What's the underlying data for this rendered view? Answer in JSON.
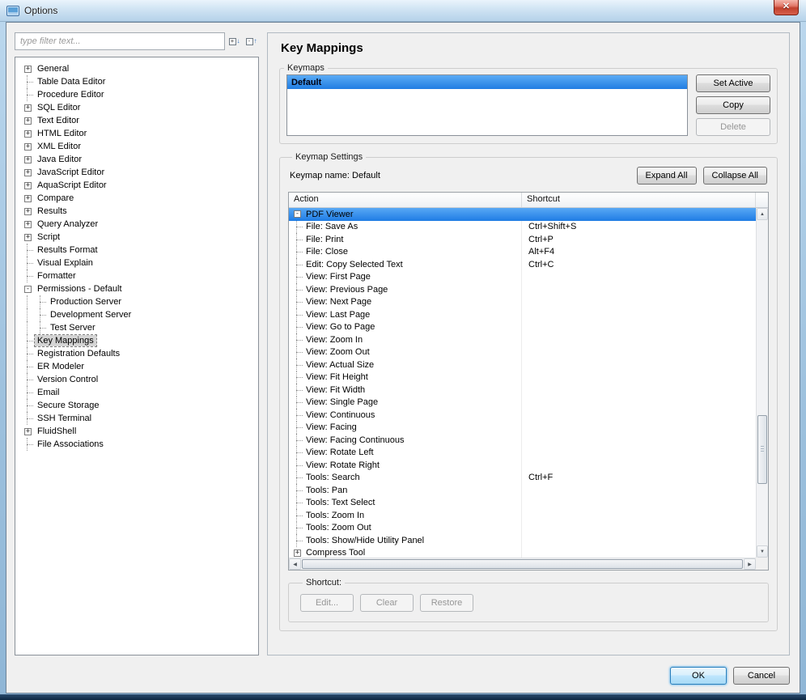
{
  "titlebar": {
    "title": "Options",
    "close_glyph": "✕"
  },
  "filter": {
    "placeholder": "type filter text..."
  },
  "tree": {
    "items": [
      {
        "label": "General",
        "box": "plus",
        "level": 0
      },
      {
        "label": "Table Data Editor",
        "box": null,
        "level": 0
      },
      {
        "label": "Procedure Editor",
        "box": null,
        "level": 0
      },
      {
        "label": "SQL Editor",
        "box": "plus",
        "level": 0
      },
      {
        "label": "Text Editor",
        "box": "plus",
        "level": 0
      },
      {
        "label": "HTML Editor",
        "box": "plus",
        "level": 0
      },
      {
        "label": "XML Editor",
        "box": "plus",
        "level": 0
      },
      {
        "label": "Java Editor",
        "box": "plus",
        "level": 0
      },
      {
        "label": "JavaScript Editor",
        "box": "plus",
        "level": 0
      },
      {
        "label": "AquaScript Editor",
        "box": "plus",
        "level": 0
      },
      {
        "label": "Compare",
        "box": "plus",
        "level": 0
      },
      {
        "label": "Results",
        "box": "plus",
        "level": 0
      },
      {
        "label": "Query Analyzer",
        "box": "plus",
        "level": 0
      },
      {
        "label": "Script",
        "box": "plus",
        "level": 0
      },
      {
        "label": "Results Format",
        "box": null,
        "level": 0
      },
      {
        "label": "Visual Explain",
        "box": null,
        "level": 0
      },
      {
        "label": "Formatter",
        "box": null,
        "level": 0
      },
      {
        "label": "Permissions - Default",
        "box": "minus",
        "level": 0
      },
      {
        "label": "Production Server",
        "box": null,
        "level": 1
      },
      {
        "label": "Development Server",
        "box": null,
        "level": 1
      },
      {
        "label": "Test Server",
        "box": null,
        "level": 1
      },
      {
        "label": "Key Mappings",
        "box": null,
        "level": 0,
        "selected": true
      },
      {
        "label": "Registration Defaults",
        "box": null,
        "level": 0
      },
      {
        "label": "ER Modeler",
        "box": null,
        "level": 0
      },
      {
        "label": "Version Control",
        "box": null,
        "level": 0
      },
      {
        "label": "Email",
        "box": null,
        "level": 0
      },
      {
        "label": "Secure Storage",
        "box": null,
        "level": 0
      },
      {
        "label": "SSH Terminal",
        "box": null,
        "level": 0
      },
      {
        "label": "FluidShell",
        "box": "plus",
        "level": 0
      },
      {
        "label": "File Associations",
        "box": null,
        "level": 0
      }
    ]
  },
  "main": {
    "title": "Key Mappings",
    "keymaps": {
      "legend": "Keymaps",
      "list": [
        {
          "label": "Default",
          "selected": true
        }
      ],
      "buttons": [
        {
          "label": "Set Active",
          "enabled": true
        },
        {
          "label": "Copy",
          "enabled": true
        },
        {
          "label": "Delete",
          "enabled": false
        }
      ]
    },
    "settings": {
      "legend": "Keymap Settings",
      "keymap_name_label": "Keymap name: Default",
      "expand_all": "Expand All",
      "collapse_all": "Collapse All",
      "table": {
        "columns": [
          "Action",
          "Shortcut"
        ],
        "rows": [
          {
            "action": "PDF Viewer",
            "shortcut": "",
            "box": "minus",
            "selected": true
          },
          {
            "action": "File: Save As",
            "shortcut": "Ctrl+Shift+S"
          },
          {
            "action": "File: Print",
            "shortcut": "Ctrl+P"
          },
          {
            "action": "File: Close",
            "shortcut": "Alt+F4"
          },
          {
            "action": "Edit: Copy Selected Text",
            "shortcut": "Ctrl+C"
          },
          {
            "action": "View: First Page",
            "shortcut": ""
          },
          {
            "action": "View: Previous Page",
            "shortcut": ""
          },
          {
            "action": "View: Next Page",
            "shortcut": ""
          },
          {
            "action": "View: Last Page",
            "shortcut": ""
          },
          {
            "action": "View: Go to Page",
            "shortcut": ""
          },
          {
            "action": "View: Zoom In",
            "shortcut": ""
          },
          {
            "action": "View: Zoom Out",
            "shortcut": ""
          },
          {
            "action": "View: Actual Size",
            "shortcut": ""
          },
          {
            "action": "View: Fit Height",
            "shortcut": ""
          },
          {
            "action": "View: Fit Width",
            "shortcut": ""
          },
          {
            "action": "View: Single Page",
            "shortcut": ""
          },
          {
            "action": "View: Continuous",
            "shortcut": ""
          },
          {
            "action": "View: Facing",
            "shortcut": ""
          },
          {
            "action": "View: Facing Continuous",
            "shortcut": ""
          },
          {
            "action": "View: Rotate Left",
            "shortcut": ""
          },
          {
            "action": "View: Rotate Right",
            "shortcut": ""
          },
          {
            "action": "Tools: Search",
            "shortcut": "Ctrl+F"
          },
          {
            "action": "Tools: Pan",
            "shortcut": ""
          },
          {
            "action": "Tools: Text Select",
            "shortcut": ""
          },
          {
            "action": "Tools: Zoom In",
            "shortcut": ""
          },
          {
            "action": "Tools: Zoom Out",
            "shortcut": ""
          },
          {
            "action": "Tools: Show/Hide Utility Panel",
            "shortcut": ""
          },
          {
            "action": "Compress Tool",
            "shortcut": "",
            "box": "plus"
          }
        ]
      },
      "shortcut_group": {
        "legend": "Shortcut:",
        "buttons": [
          {
            "label": "Edit...",
            "enabled": false
          },
          {
            "label": "Clear",
            "enabled": false
          },
          {
            "label": "Restore",
            "enabled": false
          }
        ]
      }
    }
  },
  "footer": {
    "ok": "OK",
    "cancel": "Cancel"
  },
  "colors": {
    "selection_top": "#58a8f5",
    "selection_bottom": "#1f7ce4",
    "titlebar_tint": "#cfe3f3",
    "dialog_bg": "#f0f0f0"
  }
}
